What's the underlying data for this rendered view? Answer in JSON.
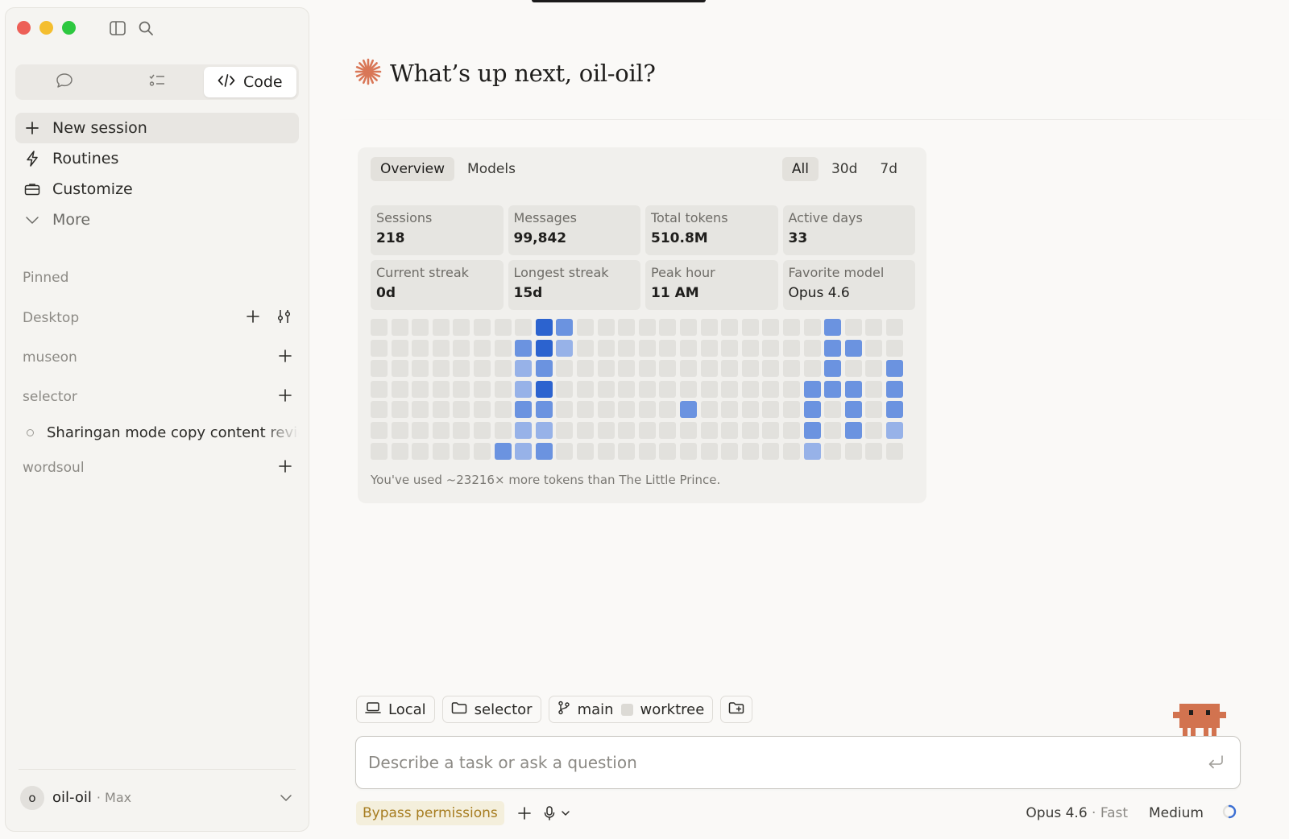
{
  "sidebar": {
    "modes": {
      "code_label": "Code"
    },
    "nav": [
      {
        "label": "New session"
      },
      {
        "label": "Routines"
      },
      {
        "label": "Customize"
      },
      {
        "label": "More"
      }
    ],
    "sections": {
      "pinned": "Pinned",
      "desktop": "Desktop",
      "museon": "museon",
      "selector": "selector",
      "wordsoul": "wordsoul"
    },
    "thread": {
      "title": "Sharingan mode copy content review"
    },
    "user": {
      "avatar_initial": "o",
      "name": "oil-oil",
      "plan": "· Max"
    }
  },
  "main": {
    "greeting": "What’s up next, oil-oil?",
    "stats": {
      "tabs": [
        "Overview",
        "Models"
      ],
      "ranges": [
        "All",
        "30d",
        "7d"
      ],
      "cards": [
        {
          "label": "Sessions",
          "value": "218"
        },
        {
          "label": "Messages",
          "value": "99,842"
        },
        {
          "label": "Total tokens",
          "value": "510.8M"
        },
        {
          "label": "Active days",
          "value": "33"
        },
        {
          "label": "Current streak",
          "value": "0d"
        },
        {
          "label": "Longest streak",
          "value": "15d"
        },
        {
          "label": "Peak hour",
          "value": "11 AM"
        },
        {
          "label": "Favorite model",
          "value": "Opus 4.6"
        }
      ],
      "heatmap": {
        "columns": 26,
        "rows": 7,
        "levels": [
          [
            0,
            0,
            0,
            0,
            0,
            0,
            0,
            0,
            3,
            2,
            0,
            0,
            0,
            0,
            0,
            0,
            0,
            0,
            0,
            0,
            0,
            0,
            2,
            0,
            0,
            0
          ],
          [
            0,
            0,
            0,
            0,
            0,
            0,
            0,
            2,
            3,
            1,
            0,
            0,
            0,
            0,
            0,
            0,
            0,
            0,
            0,
            0,
            0,
            0,
            2,
            2,
            0,
            0
          ],
          [
            0,
            0,
            0,
            0,
            0,
            0,
            0,
            1,
            2,
            0,
            0,
            0,
            0,
            0,
            0,
            0,
            0,
            0,
            0,
            0,
            0,
            0,
            2,
            0,
            0,
            2
          ],
          [
            0,
            0,
            0,
            0,
            0,
            0,
            0,
            1,
            3,
            0,
            0,
            0,
            0,
            0,
            0,
            0,
            0,
            0,
            0,
            0,
            0,
            2,
            2,
            2,
            0,
            2
          ],
          [
            0,
            0,
            0,
            0,
            0,
            0,
            0,
            2,
            2,
            0,
            0,
            0,
            0,
            0,
            0,
            2,
            0,
            0,
            0,
            0,
            0,
            2,
            0,
            2,
            0,
            2
          ],
          [
            0,
            0,
            0,
            0,
            0,
            0,
            0,
            1,
            1,
            0,
            0,
            0,
            0,
            0,
            0,
            0,
            0,
            0,
            0,
            0,
            0,
            2,
            0,
            2,
            0,
            1
          ],
          [
            0,
            0,
            0,
            0,
            0,
            0,
            2,
            1,
            2,
            0,
            0,
            0,
            0,
            0,
            0,
            0,
            0,
            0,
            0,
            0,
            0,
            1,
            0,
            0,
            0,
            0
          ]
        ],
        "colors": [
          "#e2e1dd",
          "#97b2e8",
          "#6b93e0",
          "#2c63cf"
        ]
      },
      "fun_fact": "You've used ~23216× more tokens than The Little Prince."
    }
  },
  "composer": {
    "chips": {
      "local": "Local",
      "folder": "selector",
      "branch": "main",
      "worktree": "worktree"
    },
    "placeholder": "Describe a task or ask a question",
    "bypass": "Bypass permissions",
    "model": "Opus 4.6",
    "speed": "· Fast",
    "effort": "Medium"
  },
  "colors": {
    "accent": "#d97757",
    "mascot": "#d2734f",
    "bypass_text": "#a67c1f"
  }
}
